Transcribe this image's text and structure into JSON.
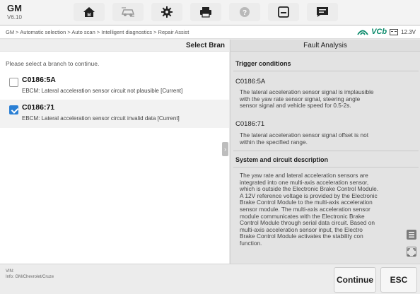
{
  "app": {
    "name": "GM",
    "version": "V6.10"
  },
  "toolbar": {
    "tools": [
      "home-icon",
      "car-icon",
      "gear-icon",
      "printer-icon",
      "help-icon",
      "save-icon",
      "chat-icon"
    ]
  },
  "breadcrumb": "GM > Automatic selection > Auto scan > Intelligent diagnostics > Repair Assist",
  "status": {
    "vcb": "VCb",
    "battery": "12.3V"
  },
  "left": {
    "header": "Select Bran",
    "prompt": "Please select a branch to continue.",
    "items": [
      {
        "code": "C0186:5A",
        "desc": "EBCM: Lateral acceleration sensor circuit not plausible [Current]",
        "checked": false
      },
      {
        "code": "C0186:71",
        "desc": "EBCM: Lateral acceleration sensor circuit invalid data [Current]",
        "checked": true
      }
    ]
  },
  "right": {
    "header": "Fault Analysis",
    "trigger_title": "Trigger conditions",
    "conditions": [
      {
        "code": "C0186:5A",
        "lines": [
          "The lateral acceleration sensor signal is implausible",
          "with the yaw rate sensor signal, steering angle",
          "sensor signal and vehicle speed for 0.5-2s."
        ]
      },
      {
        "code": "C0186:71",
        "lines": [
          "The lateral acceleration sensor signal offset is not",
          "within the specified range."
        ]
      }
    ],
    "system_title": "System and circuit description",
    "system_lines": [
      "The yaw rate and lateral acceleration sensors are",
      "integrated into one multi-axis acceleration sensor,",
      "which is outside the Electronic Brake Control Module.",
      "A 12V reference voltage is provided by the Electronic",
      "Brake Control Module to the multi-axis acceleration",
      "sensor module. The multi-axis acceleration sensor",
      "module communicates with the Electronic Brake",
      "Control Module through serial data circuit. Based on",
      "multi-axis acceleration sensor input, the Electro",
      "Brake Control Module activates the stability con",
      "function."
    ]
  },
  "footer": {
    "vin_label": "VIN:",
    "info": "Info: GM/Chevrolet/Cruze",
    "continue_label": "Continue",
    "esc_label": "ESC"
  }
}
